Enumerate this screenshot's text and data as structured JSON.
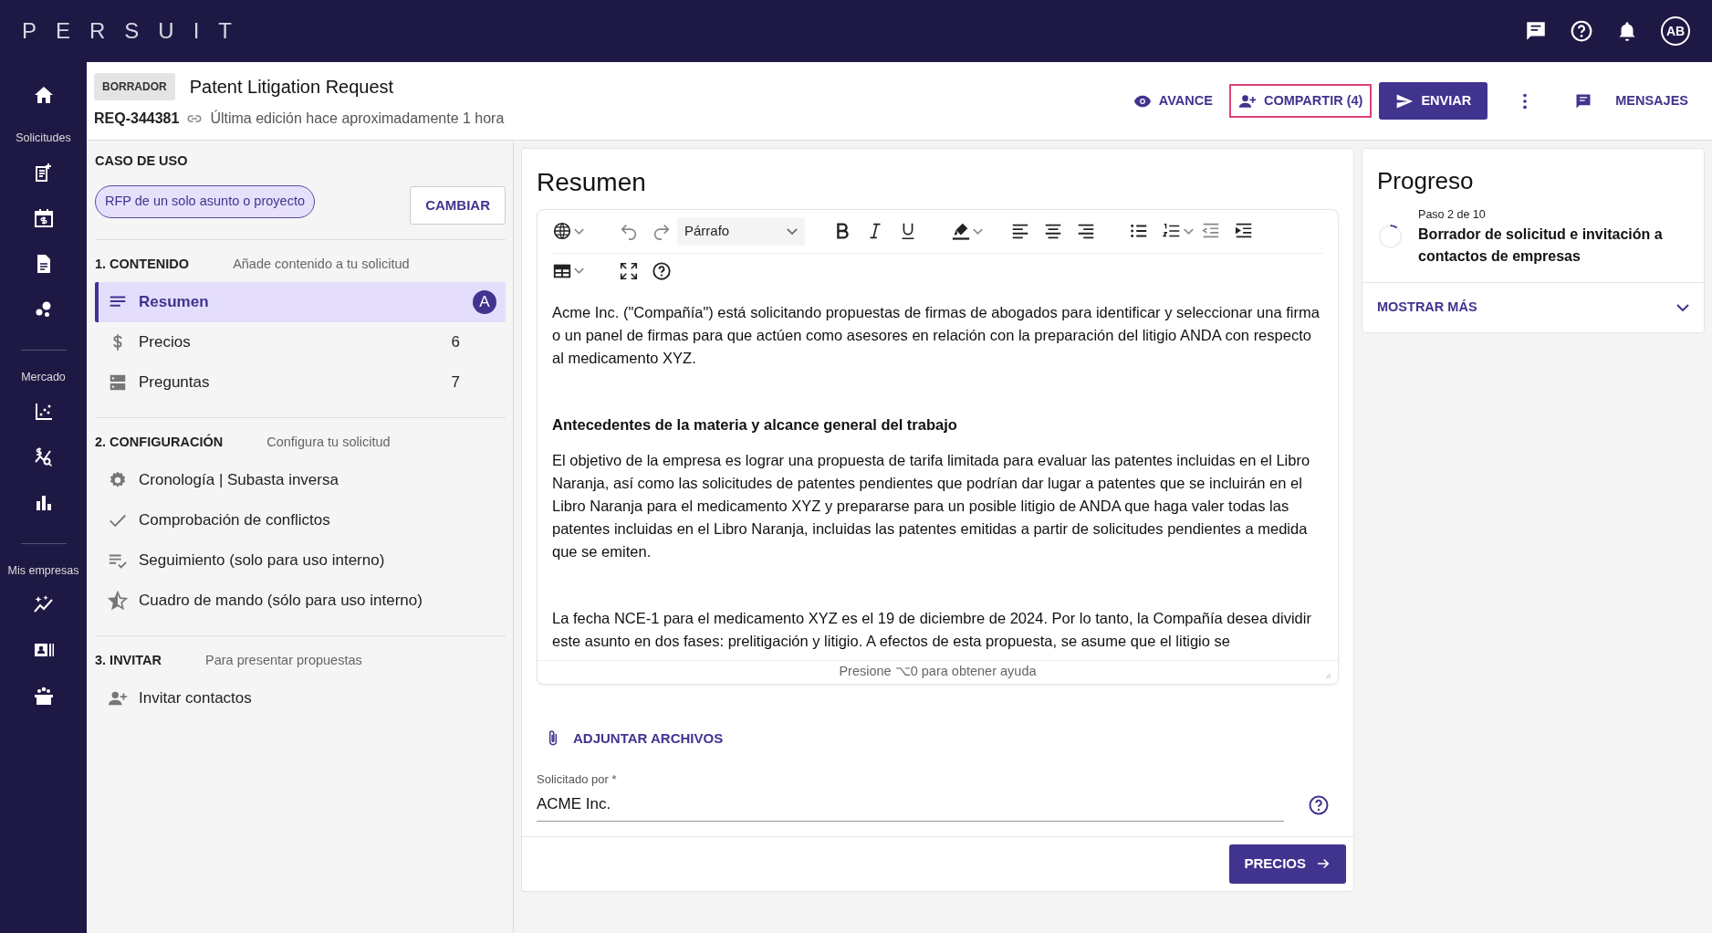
{
  "topbar": {
    "logo": "PERSUIT",
    "avatar": "AB"
  },
  "nav_sections": [
    {
      "label": "Solicitudes"
    },
    {
      "label": "Mercado"
    },
    {
      "label": "Mis empresas"
    }
  ],
  "header": {
    "status": "BORRADOR",
    "title": "Patent Litigation Request",
    "req_id": "REQ-344381",
    "edited": "Última edición hace aproximadamente 1 hora",
    "actions": [
      {
        "kind": "text",
        "label": "AVANCE",
        "highlighted": false
      },
      {
        "kind": "text",
        "label": "COMPARTIR (4)",
        "highlighted": true
      },
      {
        "kind": "primary",
        "label": "ENVIAR",
        "highlighted": false
      },
      {
        "kind": "more"
      },
      {
        "kind": "text",
        "label": "MENSAJES",
        "highlighted": false
      }
    ]
  },
  "use_case": {
    "heading": "CASO DE USO",
    "tag": "RFP de un solo asunto o proyecto",
    "button": "CAMBIAR"
  },
  "sections": [
    {
      "title": "1. CONTENIDO",
      "subtitle": "Añade contenido a tu solicitud",
      "items": [
        {
          "label": "Resumen",
          "count": "A",
          "selected": true
        },
        {
          "label": "Precios",
          "count": "6",
          "selected": false
        },
        {
          "label": "Preguntas",
          "count": "7",
          "selected": false
        }
      ]
    },
    {
      "title": "2. CONFIGURACIÓN",
      "subtitle": "Configura tu solicitud",
      "items": [
        {
          "label": "Cronología | Subasta inversa",
          "selected": false
        },
        {
          "label": "Comprobación de conflictos",
          "selected": false
        },
        {
          "label": "Seguimiento (solo para uso interno)",
          "selected": false
        },
        {
          "label": "Cuadro de mando (sólo para uso interno)",
          "selected": false
        }
      ]
    },
    {
      "title": "3. INVITAR",
      "subtitle": "Para presentar propuestas",
      "items": [
        {
          "label": "Invitar contactos",
          "selected": false
        }
      ]
    }
  ],
  "editor": {
    "title": "Resumen",
    "format": "Párrafo",
    "paragraphs": [
      {
        "kind": "text",
        "text": "Acme Inc. (\"Compañía\") está solicitando propuestas de firmas de abogados para identificar y seleccionar una firma o un panel de firmas para que actúen como asesores en relación con la preparación del litigio ANDA con respecto al medicamento XYZ."
      },
      {
        "kind": "heading",
        "text": "Antecedentes de la materia y alcance general del trabajo"
      },
      {
        "kind": "text",
        "text": "El objetivo de la empresa es lograr una propuesta de tarifa limitada para evaluar las patentes incluidas en el Libro Naranja, así como las solicitudes de patentes pendientes que podrían dar lugar a patentes que se incluirán en el Libro Naranja para el medicamento XYZ y prepararse para un posible litigio de ANDA que haga valer todas las patentes incluidas en el Libro Naranja, incluidas las patentes emitidas a partir de solicitudes pendientes a medida que se emiten."
      },
      {
        "kind": "text",
        "text": "La fecha NCE-1 para el medicamento XYZ es el 19 de diciembre de 2024. Por lo tanto, la Compañía desea dividir este asunto en dos fases: prelitigación y litigio. A efectos de esta propuesta, se asume que el litigio se"
      }
    ],
    "help": "Presione ⌥0 para obtener ayuda",
    "attach": "ADJUNTAR ARCHIVOS",
    "field": {
      "label": "Solicitado por",
      "required": "*",
      "value": "ACME Inc."
    },
    "next": "PRECIOS"
  },
  "progress": {
    "title": "Progreso",
    "step": "Paso 2 de 10",
    "level": 0.1,
    "description": "Borrador de solicitud e invitación a contactos de empresas",
    "more": "MOSTRAR MÁS"
  }
}
